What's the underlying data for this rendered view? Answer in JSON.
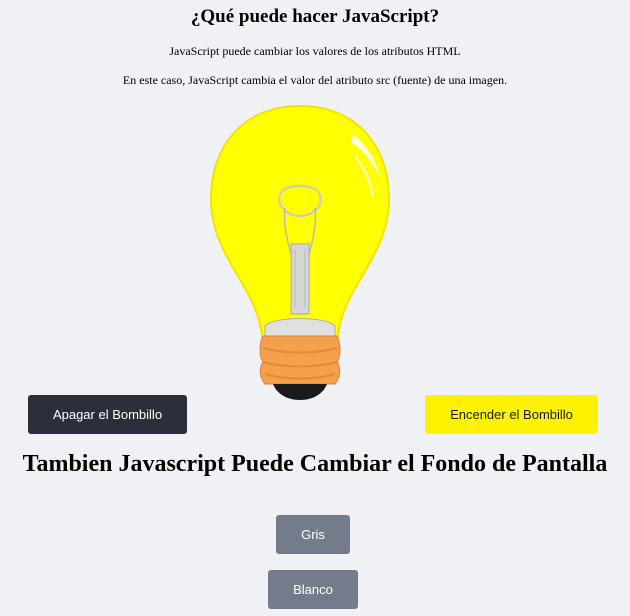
{
  "header": {
    "title": "¿Qué puede hacer JavaScript?",
    "line1": "JavaScript puede cambiar los valores de los atributos HTML",
    "line2": "En este caso, JavaScript cambia el valor del atributo src (fuente) de una imagen."
  },
  "bulb": {
    "state": "on",
    "glass_color": "#ffff00",
    "base_color": "#f5a04a"
  },
  "buttons": {
    "off_label": "Apagar el Bombillo",
    "on_label": "Encender el Bombillo"
  },
  "background_section": {
    "heading": "Tambien Javascript Puede Cambiar el Fondo de Pantalla",
    "gray_label": "Gris",
    "white_label": "Blanco"
  },
  "colors": {
    "page_background": "#f0f1f5",
    "off_button": "#2c2f3b",
    "on_button": "#fff200",
    "gray_buttons": "#747c8b"
  }
}
